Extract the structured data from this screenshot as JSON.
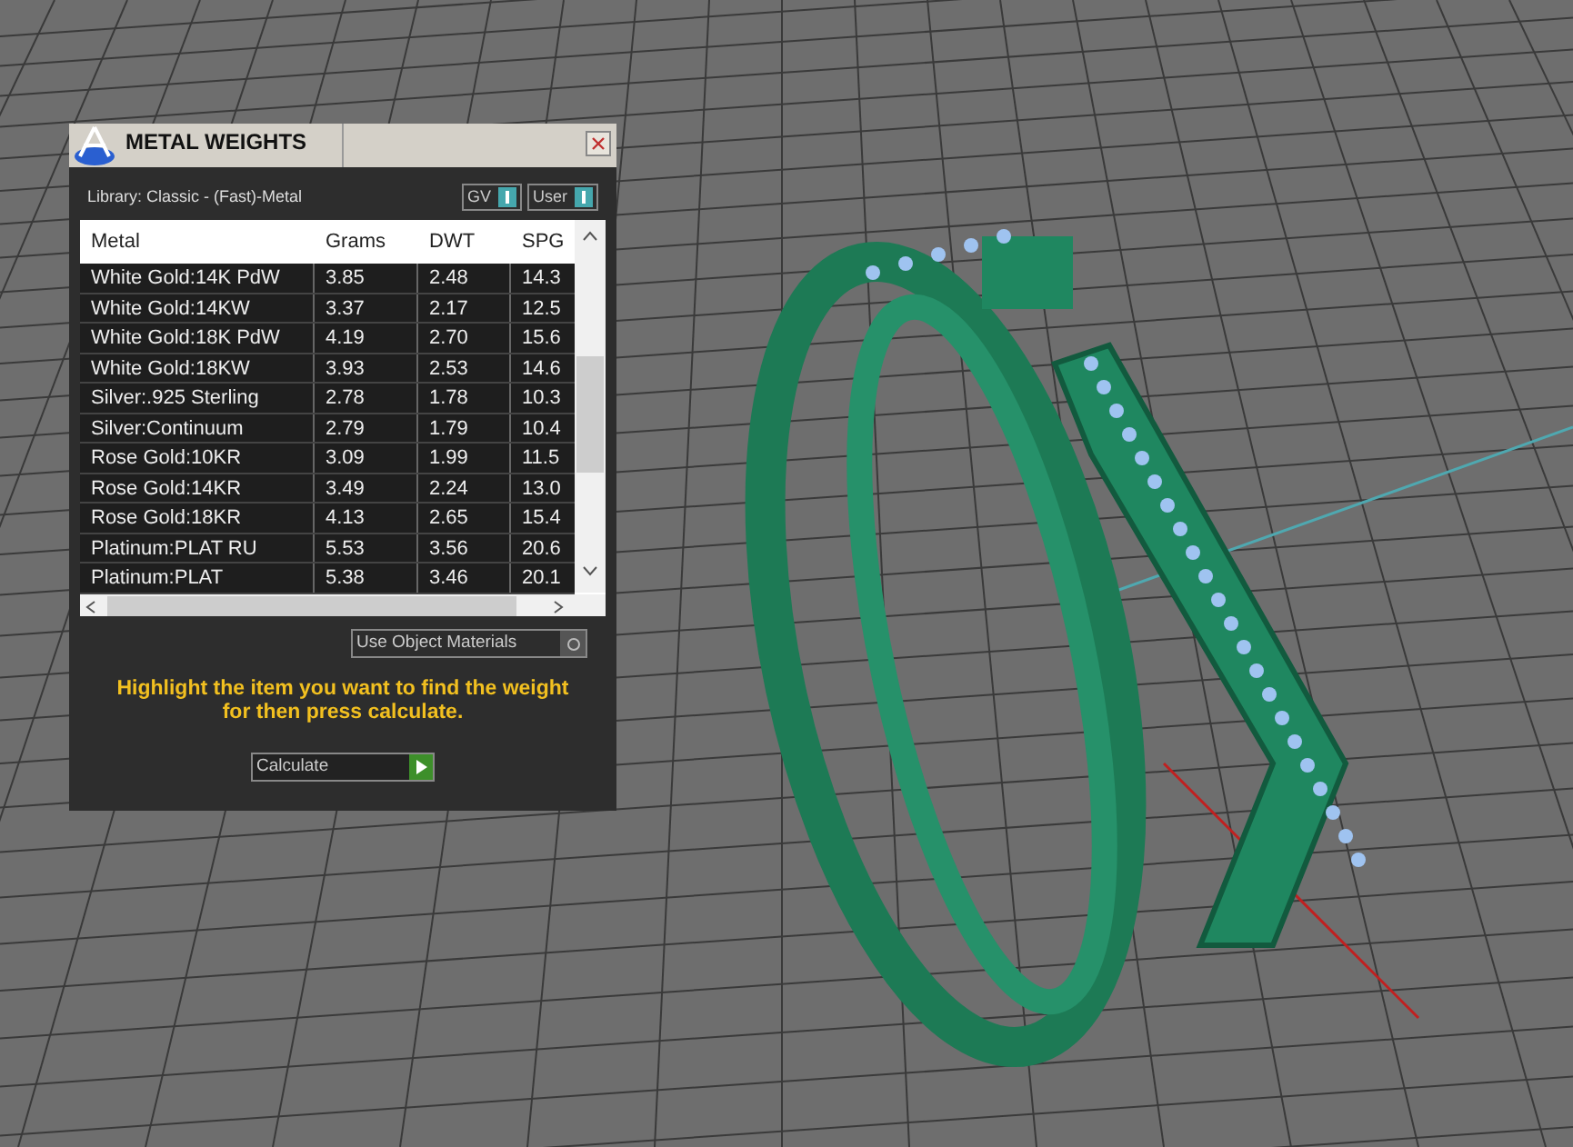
{
  "window": {
    "title": "METAL WEIGHTS"
  },
  "library": {
    "label": "Library: Classic - (Fast)-Metal"
  },
  "toggles": [
    {
      "label": "GV",
      "on": true
    },
    {
      "label": "User",
      "on": true
    }
  ],
  "table": {
    "columns": [
      "Metal",
      "Grams",
      "DWT",
      "SPG"
    ],
    "rows": [
      [
        "White Gold:14K PdW",
        "3.85",
        "2.48",
        "14.3"
      ],
      [
        "White Gold:14KW",
        "3.37",
        "2.17",
        "12.5"
      ],
      [
        "White Gold:18K PdW",
        "4.19",
        "2.70",
        "15.6"
      ],
      [
        "White Gold:18KW",
        "3.93",
        "2.53",
        "14.6"
      ],
      [
        "Silver:.925 Sterling",
        "2.78",
        "1.78",
        "10.3"
      ],
      [
        "Silver:Continuum",
        "2.79",
        "1.79",
        "10.4"
      ],
      [
        "Rose Gold:10KR",
        "3.09",
        "1.99",
        "11.5"
      ],
      [
        "Rose Gold:14KR",
        "3.49",
        "2.24",
        "13.0"
      ],
      [
        "Rose Gold:18KR",
        "4.13",
        "2.65",
        "15.4"
      ],
      [
        "Platinum:PLAT RU",
        "5.53",
        "3.56",
        "20.6"
      ],
      [
        "Platinum:PLAT",
        "5.38",
        "3.46",
        "20.1"
      ]
    ]
  },
  "use_object_materials": {
    "label": "Use Object Materials"
  },
  "hint": "Highlight the item you want to find the weight for then press calculate.",
  "calculate_button": "Calculate"
}
